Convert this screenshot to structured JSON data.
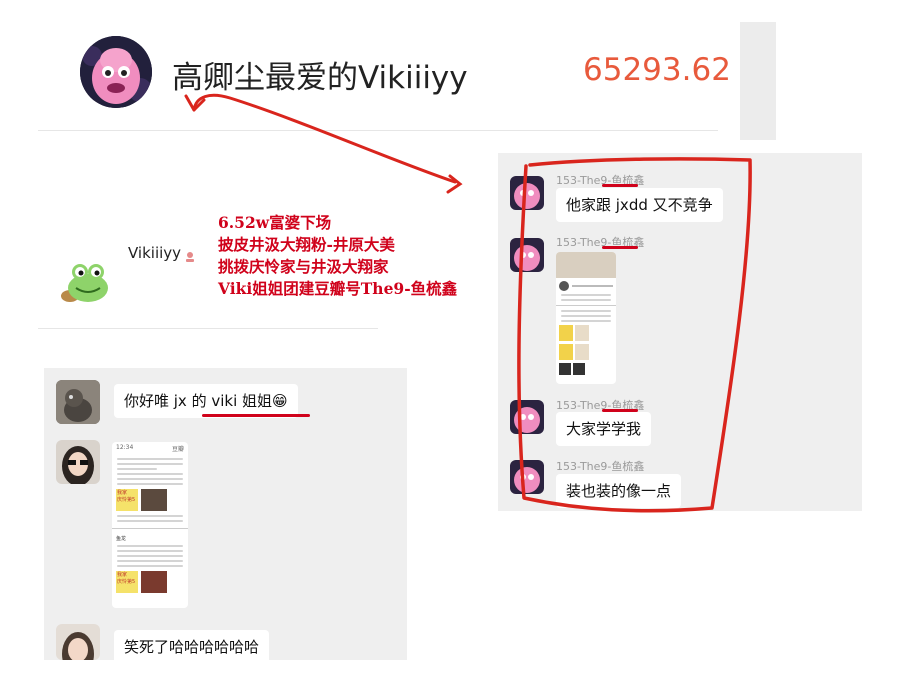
{
  "top": {
    "name": "高卿尘最爱的Vikiiiyy",
    "amount": "65293.62"
  },
  "annotation": {
    "lines": [
      "6.52w富婆下场",
      "披皮井汲大翔粉-井原大美",
      "挑拨庆怜家与井汲大翔家",
      "Viki姐姐团建豆瓣号The9-鱼梳鑫"
    ]
  },
  "profile": {
    "name": "Vikiiiyy"
  },
  "left_chat": {
    "messages": [
      {
        "text": "你好唯 jx 的 viki 姐姐😁"
      },
      {
        "text": "笑死了哈哈哈哈哈哈"
      }
    ],
    "screenshot_thumb": {
      "labels": [
        "12:34",
        "豆瓣",
        "鱼龙",
        "我家",
        "庆怜第5",
        "我家",
        "庆怜第5"
      ]
    }
  },
  "right_chat": {
    "sender": "153-The9-鱼梳鑫",
    "messages": [
      {
        "text": "他家跟 jxdd 又不竞争"
      },
      {
        "text": "大家学学我"
      },
      {
        "text": "装也装的像一点"
      }
    ]
  },
  "colors": {
    "amount": "#e85a3c",
    "annotation_red": "#d0021b",
    "panel_bg": "#efefef"
  },
  "icons": [
    "pink-monster-avatar",
    "frog-avatar",
    "heart-badge-icon",
    "cat-avatar",
    "girl-avatar"
  ]
}
